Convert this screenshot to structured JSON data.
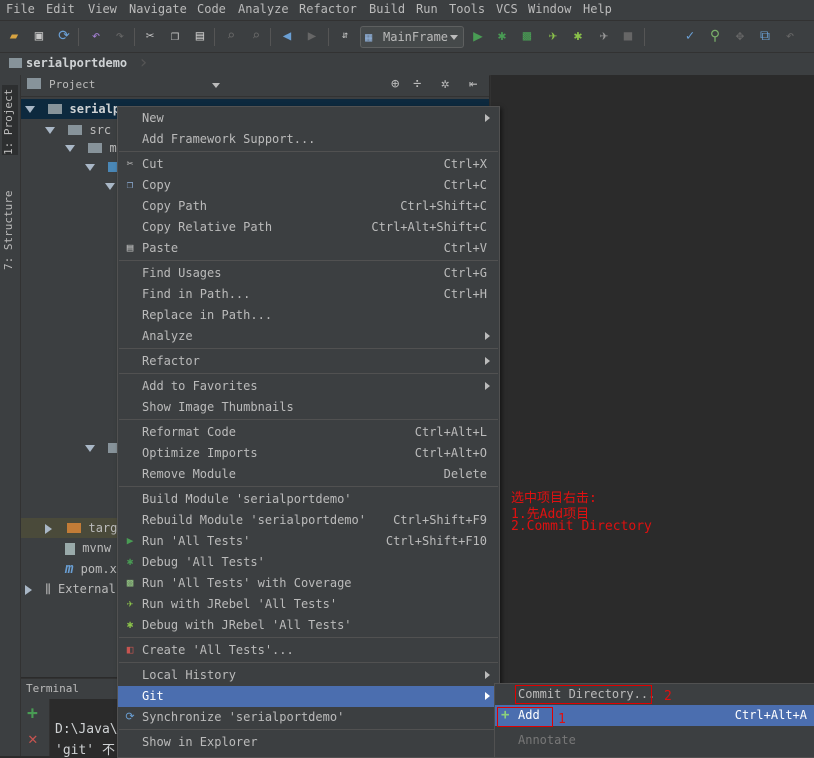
{
  "menubar": [
    "File",
    "Edit",
    "View",
    "Navigate",
    "Code",
    "Analyze",
    "Refactor",
    "Build",
    "Run",
    "Tools",
    "VCS",
    "Window",
    "Help"
  ],
  "toolbar": {
    "run_config": "MainFrame"
  },
  "breadcrumb": "serialportdemo",
  "left_tabs": {
    "project": "1: Project",
    "structure": "7: Structure"
  },
  "project_header": "Project",
  "tree": {
    "root": "serialp",
    "root_suffix": "...",
    "src": "src",
    "main": "ma",
    "target": "targe",
    "mvnw": "mvnw",
    "pom": "pom.x",
    "external": "External"
  },
  "context_menu": [
    {
      "label": "New",
      "shortcut": "",
      "submenu": true,
      "icon": ""
    },
    {
      "label": "Add Framework Support...",
      "shortcut": "",
      "submenu": false,
      "icon": ""
    },
    {
      "sep": true
    },
    {
      "label": "Cut",
      "shortcut": "Ctrl+X",
      "icon": "scissors-icon"
    },
    {
      "label": "Copy",
      "shortcut": "Ctrl+C",
      "icon": "copy-icon"
    },
    {
      "label": "Copy Path",
      "shortcut": "Ctrl+Shift+C",
      "icon": ""
    },
    {
      "label": "Copy Relative Path",
      "shortcut": "Ctrl+Alt+Shift+C",
      "icon": ""
    },
    {
      "label": "Paste",
      "shortcut": "Ctrl+V",
      "icon": "paste-icon"
    },
    {
      "sep": true
    },
    {
      "label": "Find Usages",
      "shortcut": "Ctrl+G",
      "icon": ""
    },
    {
      "label": "Find in Path...",
      "shortcut": "Ctrl+H",
      "icon": ""
    },
    {
      "label": "Replace in Path...",
      "shortcut": "",
      "icon": ""
    },
    {
      "label": "Analyze",
      "shortcut": "",
      "submenu": true,
      "icon": ""
    },
    {
      "sep": true
    },
    {
      "label": "Refactor",
      "shortcut": "",
      "submenu": true,
      "icon": ""
    },
    {
      "sep": true
    },
    {
      "label": "Add to Favorites",
      "shortcut": "",
      "submenu": true,
      "icon": ""
    },
    {
      "label": "Show Image Thumbnails",
      "shortcut": "",
      "icon": ""
    },
    {
      "sep": true
    },
    {
      "label": "Reformat Code",
      "shortcut": "Ctrl+Alt+L",
      "icon": ""
    },
    {
      "label": "Optimize Imports",
      "shortcut": "Ctrl+Alt+O",
      "icon": ""
    },
    {
      "label": "Remove Module",
      "shortcut": "Delete",
      "icon": ""
    },
    {
      "sep": true
    },
    {
      "label": "Build Module 'serialportdemo'",
      "shortcut": "",
      "icon": ""
    },
    {
      "label": "Rebuild Module 'serialportdemo'",
      "shortcut": "Ctrl+Shift+F9",
      "icon": ""
    },
    {
      "label": "Run 'All Tests'",
      "shortcut": "Ctrl+Shift+F10",
      "icon": "run-icon"
    },
    {
      "label": "Debug 'All Tests'",
      "shortcut": "",
      "icon": "debug-icon"
    },
    {
      "label": "Run 'All Tests' with Coverage",
      "shortcut": "",
      "icon": "coverage-icon"
    },
    {
      "label": "Run with JRebel 'All Tests'",
      "shortcut": "",
      "icon": "jrebel-run-icon"
    },
    {
      "label": "Debug with JRebel 'All Tests'",
      "shortcut": "",
      "icon": "jrebel-debug-icon"
    },
    {
      "sep": true
    },
    {
      "label": "Create 'All Tests'...",
      "shortcut": "",
      "icon": "create-test-icon"
    },
    {
      "sep": true
    },
    {
      "label": "Local History",
      "shortcut": "",
      "submenu": true,
      "icon": ""
    },
    {
      "label": "Git",
      "shortcut": "",
      "submenu": true,
      "icon": "",
      "selected": true
    },
    {
      "label": "Synchronize 'serialportdemo'",
      "shortcut": "",
      "icon": "sync-icon"
    },
    {
      "sep": true
    },
    {
      "label": "Show in Explorer",
      "shortcut": "",
      "icon": ""
    }
  ],
  "git_submenu": {
    "commit": "Commit Directory...",
    "add": "Add",
    "add_shortcut": "Ctrl+Alt+A",
    "annotate": "Annotate"
  },
  "annotation": {
    "line1": "选中项目右击:",
    "line2": "1.先Add项目",
    "line3": "2.Commit Directory",
    "num1": "1",
    "num2": "2"
  },
  "terminal": {
    "title": "Terminal",
    "line1": "D:\\Java\\",
    "line2": "'git' 不"
  },
  "colors": {
    "selection": "#4b6eaf",
    "annotation": "#e01010",
    "run_green": "#499c54"
  }
}
